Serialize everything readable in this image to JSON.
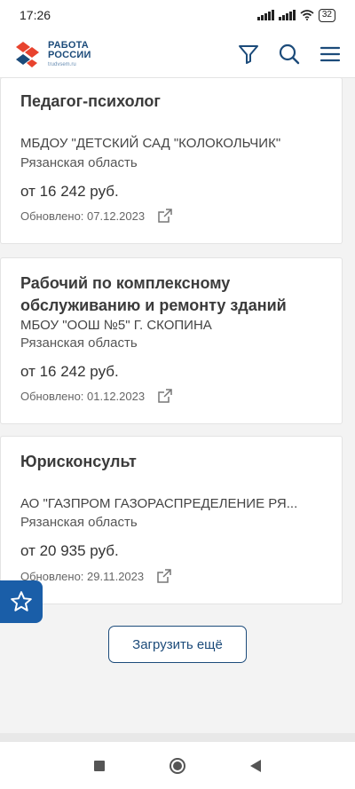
{
  "status": {
    "time": "17:26",
    "battery": "32"
  },
  "header": {
    "logo_line1": "РАБОТА",
    "logo_line2": "РОССИИ",
    "logo_sub": "trudvsem.ru",
    "icons": [
      "filter-icon",
      "search-icon",
      "menu-icon"
    ]
  },
  "vacancies": [
    {
      "title_lines": [
        "Педагог-психолог"
      ],
      "org": "МБДОУ \"ДЕТСКИЙ САД \"КОЛОКОЛЬЧИК\"",
      "region": "Рязанская область",
      "salary": "от 16 242 руб.",
      "updated": "Обновлено: 07.12.2023"
    },
    {
      "title_lines": [
        "Рабочий по комплексному",
        "обслуживанию и ремонту зданий"
      ],
      "org": "МБОУ \"ООШ №5\" Г. СКОПИНА",
      "region": "Рязанская область",
      "salary": "от 16 242 руб.",
      "updated": "Обновлено: 01.12.2023"
    },
    {
      "title_lines": [
        "Юрисконсульт"
      ],
      "org": "АО \"ГАЗПРОМ ГАЗОРАСПРЕДЕЛЕНИЕ РЯ...",
      "region": "Рязанская область",
      "salary": "от 20 935 руб.",
      "updated": "Обновлено: 29.11.2023"
    }
  ],
  "load_more_label": "Загрузить ещё",
  "colors": {
    "brand": "#1c4b7a",
    "accent_red": "#e8432e",
    "fav_bg": "#1a5ea8"
  }
}
